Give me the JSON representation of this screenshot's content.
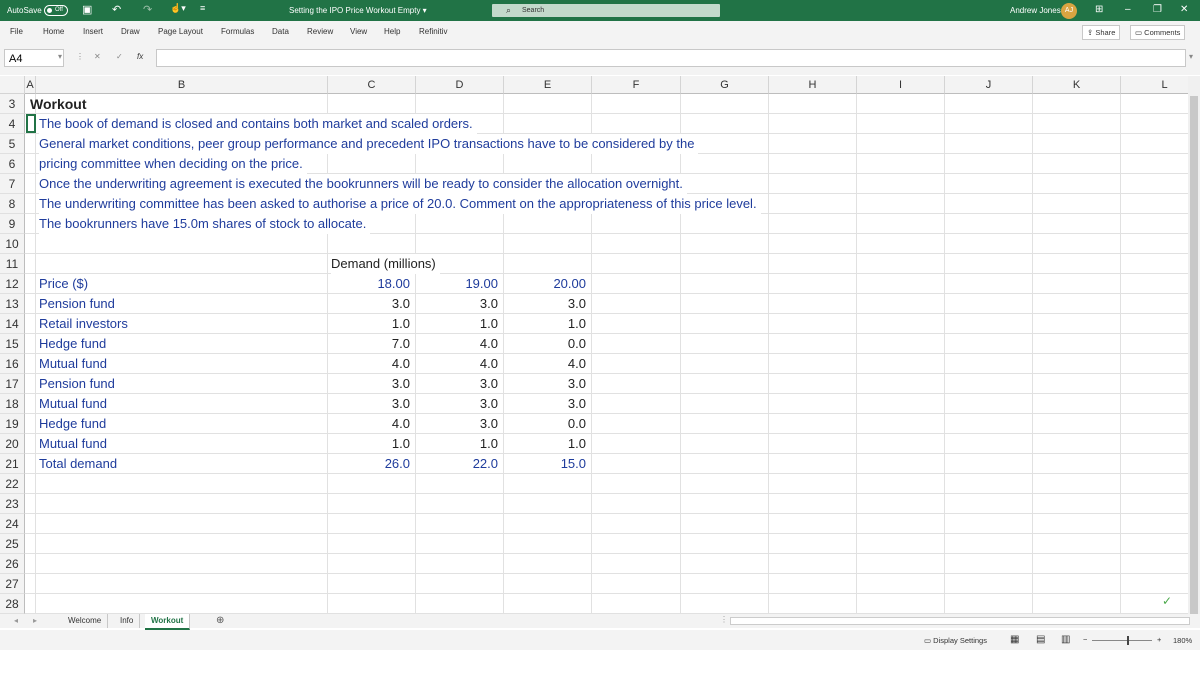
{
  "titlebar": {
    "autosave_label": "AutoSave",
    "autosave_state": "Off",
    "doc_title": "Setting the IPO Price Workout Empty ▾",
    "search_placeholder": "Search",
    "user_name": "Andrew Jones",
    "user_initials": "AJ"
  },
  "menu": {
    "tabs": [
      "File",
      "Home",
      "Insert",
      "Draw",
      "Page Layout",
      "Formulas",
      "Data",
      "Review",
      "View",
      "Help",
      "Refinitiv"
    ],
    "share_label": "Share",
    "comments_label": "Comments"
  },
  "formula_bar": {
    "name_box": "A4",
    "fx_label": "fx",
    "content": ""
  },
  "columns": [
    "A",
    "B",
    "C",
    "D",
    "E",
    "F",
    "G",
    "H",
    "I",
    "J",
    "K",
    "L"
  ],
  "rows": [
    "3",
    "4",
    "5",
    "6",
    "7",
    "8",
    "9",
    "10",
    "11",
    "12",
    "13",
    "14",
    "15",
    "16",
    "17",
    "18",
    "19",
    "20",
    "21",
    "22",
    "23",
    "24",
    "25",
    "26",
    "27",
    "28"
  ],
  "sheet": {
    "heading": "Workout",
    "notes": [
      "The book of demand is closed and contains both market and scaled orders.",
      "General market conditions, peer group performance and precedent IPO transactions have to be considered by the",
      "pricing committee when deciding on the price.",
      "Once the underwriting agreement is executed the bookrunners will be ready to consider the allocation overnight.",
      "The underwriting committee has been asked to authorise a price of 20.0. Comment on the appropriateness of this price level.",
      "The bookrunners have 15.0m shares of stock to allocate."
    ],
    "demand_header": "Demand (millions)",
    "price_label": "Price ($)",
    "prices": [
      "18.00",
      "19.00",
      "20.00"
    ],
    "table": [
      {
        "label": "Pension fund",
        "values": [
          "3.0",
          "3.0",
          "3.0"
        ]
      },
      {
        "label": "Retail investors",
        "values": [
          "1.0",
          "1.0",
          "1.0"
        ]
      },
      {
        "label": "Hedge fund",
        "values": [
          "7.0",
          "4.0",
          "0.0"
        ]
      },
      {
        "label": "Mutual fund",
        "values": [
          "4.0",
          "4.0",
          "4.0"
        ]
      },
      {
        "label": "Pension fund",
        "values": [
          "3.0",
          "3.0",
          "3.0"
        ]
      },
      {
        "label": "Mutual fund",
        "values": [
          "3.0",
          "3.0",
          "3.0"
        ]
      },
      {
        "label": "Hedge fund",
        "values": [
          "4.0",
          "3.0",
          "0.0"
        ]
      },
      {
        "label": "Mutual fund",
        "values": [
          "1.0",
          "1.0",
          "1.0"
        ]
      }
    ],
    "total_label": "Total demand",
    "totals": [
      "26.0",
      "22.0",
      "15.0"
    ]
  },
  "sheet_tabs": {
    "tabs": [
      "Welcome",
      "Info",
      "Workout"
    ],
    "active": "Workout"
  },
  "status": {
    "display_settings": "Display Settings",
    "zoom": "180%"
  }
}
